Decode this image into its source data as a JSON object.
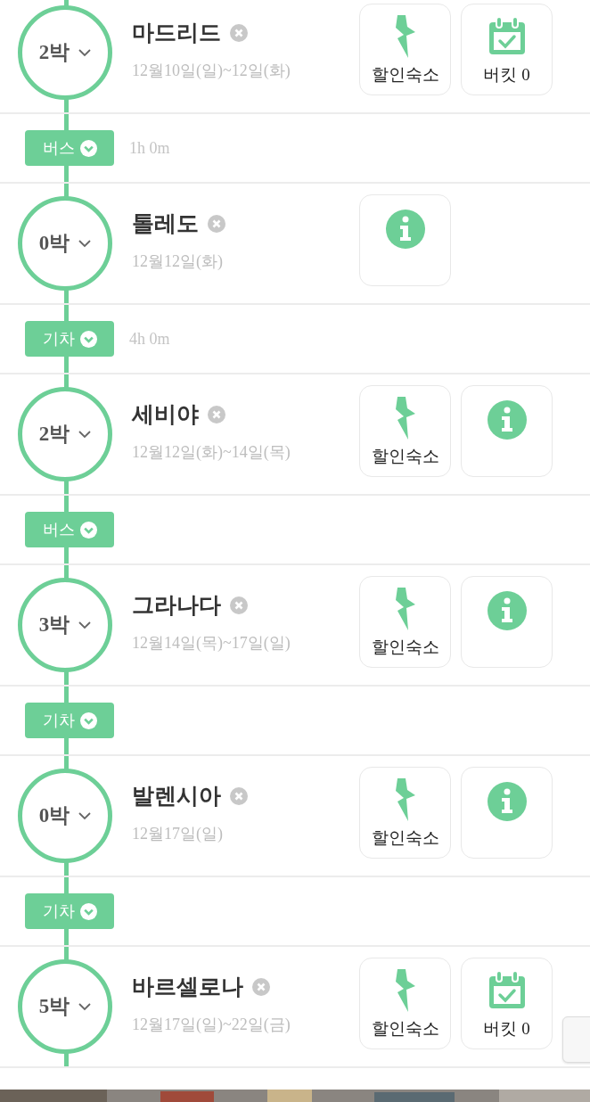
{
  "items": [
    {
      "kind": "stop",
      "nights": "2박",
      "city": "마드리드",
      "dates": "12월10일(일)~12일(화)",
      "actions": [
        {
          "kind": "deal",
          "label": "할인숙소"
        },
        {
          "kind": "bucket",
          "label": "버킷 0"
        }
      ]
    },
    {
      "kind": "transport",
      "mode": "버스",
      "duration": "1h 0m"
    },
    {
      "kind": "stop",
      "nights": "0박",
      "city": "톨레도",
      "dates": "12월12일(화)",
      "actions": [
        {
          "kind": "info"
        }
      ]
    },
    {
      "kind": "transport",
      "mode": "기차",
      "duration": "4h 0m"
    },
    {
      "kind": "stop",
      "nights": "2박",
      "city": "세비야",
      "dates": "12월12일(화)~14일(목)",
      "actions": [
        {
          "kind": "deal",
          "label": "할인숙소"
        },
        {
          "kind": "info"
        }
      ]
    },
    {
      "kind": "transport",
      "mode": "버스"
    },
    {
      "kind": "stop",
      "nights": "3박",
      "city": "그라나다",
      "dates": "12월14일(목)~17일(일)",
      "actions": [
        {
          "kind": "deal",
          "label": "할인숙소"
        },
        {
          "kind": "info"
        }
      ]
    },
    {
      "kind": "transport",
      "mode": "기차"
    },
    {
      "kind": "stop",
      "nights": "0박",
      "city": "발렌시아",
      "dates": "12월17일(일)",
      "actions": [
        {
          "kind": "deal",
          "label": "할인숙소"
        },
        {
          "kind": "info"
        }
      ]
    },
    {
      "kind": "transport",
      "mode": "기차"
    },
    {
      "kind": "stop",
      "nights": "5박",
      "city": "바르셀로나",
      "dates": "12월17일(일)~22일(금)",
      "actions": [
        {
          "kind": "deal",
          "label": "할인숙소"
        },
        {
          "kind": "bucket",
          "label": "버킷 0"
        }
      ]
    }
  ]
}
